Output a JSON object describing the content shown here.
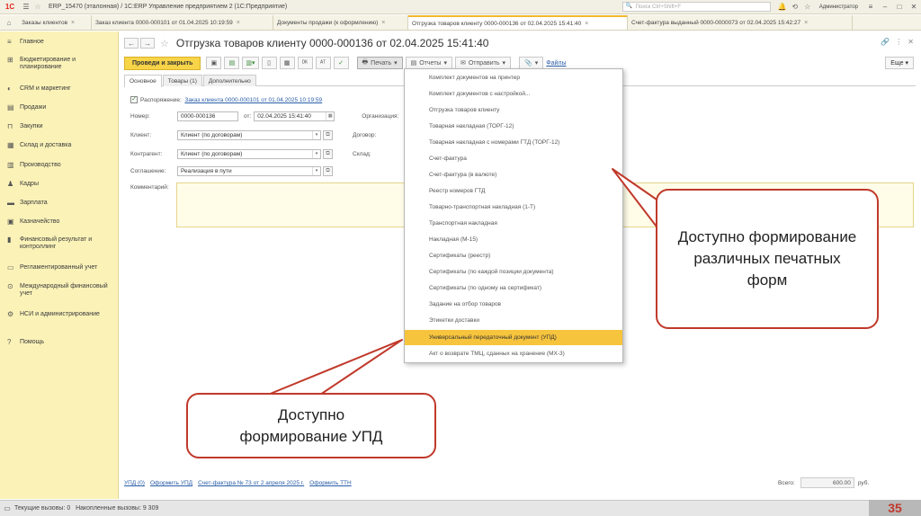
{
  "titlebar": {
    "logo": "1С",
    "title": "ERP_15470 (эталонная) / 1С:ERP Управление предприятием 2  (1С:Предприятие)",
    "search_placeholder": "Поиск Ctrl+Shift+F",
    "user": "Администратор"
  },
  "tabs": [
    {
      "label": "Заказы клиентов",
      "active": false
    },
    {
      "label": "Заказ клиента 0000-000101 от 01.04.2025 10:19:59",
      "active": false
    },
    {
      "label": "Документы продажи (к оформлению)",
      "active": false
    },
    {
      "label": "Отгрузка товаров клиенту 0000-000136 от 02.04.2025 15:41:40",
      "active": true
    },
    {
      "label": "Счет-фактура выданный 0000-0000073 от 02.04.2025 15:42:27",
      "active": false
    }
  ],
  "sidebar": {
    "items": [
      {
        "icon": "≡",
        "label": "Главное"
      },
      {
        "icon": "⊞",
        "label": "Бюджетирование и планирование"
      },
      {
        "icon": "◐",
        "label": "CRM и маркетинг"
      },
      {
        "icon": "▤",
        "label": "Продажи"
      },
      {
        "icon": "⊓",
        "label": "Закупки"
      },
      {
        "icon": "▦",
        "label": "Склад и доставка"
      },
      {
        "icon": "▥",
        "label": "Производство"
      },
      {
        "icon": "♟",
        "label": "Кадры"
      },
      {
        "icon": "▬",
        "label": "Зарплата"
      },
      {
        "icon": "▣",
        "label": "Казначейство"
      },
      {
        "icon": "▮",
        "label": "Финансовый результат и контроллинг"
      },
      {
        "icon": "▭",
        "label": "Регламентированный учет"
      },
      {
        "icon": "⊙",
        "label": "Международный финансовый учет"
      },
      {
        "icon": "⚙",
        "label": "НСИ и администрирование"
      },
      {
        "icon": "?",
        "label": "Помощь"
      }
    ]
  },
  "document": {
    "title": "Отгрузка товаров клиенту 0000-000136 от 02.04.2025 15:41:40",
    "toolbar": {
      "post_close": "Проведи и закрыть",
      "print": "Печать",
      "reports": "Отчеты",
      "send": "Отправить",
      "files": "Файлы",
      "more": "Еще"
    },
    "form_tabs": [
      "Основное",
      "Товары (1)",
      "Дополнительно"
    ],
    "fields": {
      "disposal_label": "Распоряжение:",
      "disposal_link": "Заказ клиента 0000-000101 от 01.04.2025 10:19:59",
      "number_label": "Номер:",
      "number_value": "0000-000136",
      "date_label": "от:",
      "date_value": "02.04.2025 15:41:40",
      "org_label": "Организация:",
      "client_label": "Клиент:",
      "client_value": "Клиент (по договорам)",
      "contract_label": "Договор:",
      "contractor_label": "Контрагент:",
      "contractor_value": "Клиент (по договорам)",
      "warehouse_label": "Склад:",
      "agreement_label": "Соглашение:",
      "agreement_value": "Реализация в пути",
      "comment_label": "Комментарий:"
    },
    "footer_links": [
      "УПД (0)",
      "Оформить УПД",
      "Счет-фактура № 73 от 2 апреля 2025 г.",
      "Оформить ТТН"
    ],
    "total_label": "Всего:",
    "total_value": "600.00",
    "currency": "руб."
  },
  "print_menu": {
    "items": [
      "Комплект документов на принтер",
      "Комплект документов с настройкой...",
      "Отгрузка товаров клиенту",
      "Товарная накладная (ТОРГ-12)",
      "Товарная накладная с номерами ГТД (ТОРГ-12)",
      "Счет-фактура",
      "Счет-фактура (в валюте)",
      "Реестр номеров ГТД",
      "Товарно-транспортная накладная (1-Т)",
      "Транспортная накладная",
      "Накладная (М-15)",
      "Сертификаты (реестр)",
      "Сертификаты (по каждой позиции документа)",
      "Сертификаты (по одному на сертификат)",
      "Задание на отбор товаров",
      "Этикетки доставки",
      "Универсальный передаточный документ (УПД)",
      "Акт о возврате ТМЦ, сданных на хранение (МХ-3)"
    ],
    "highlighted_index": 16,
    "highlight_color": "#f7c43d"
  },
  "statusbar": {
    "current_calls": "Текущие вызовы: 0",
    "accumulated_calls": "Накопленные вызовы: 9 309"
  },
  "page_number": "35",
  "callouts": {
    "right": "Доступно формирование различных печатных форм",
    "bottom": "Доступно формирование УПД",
    "border_color": "#c0392b"
  }
}
